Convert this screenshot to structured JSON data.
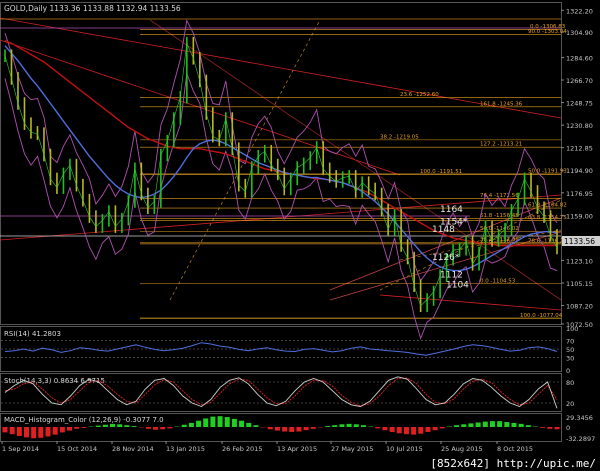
{
  "header": {
    "symbol": "GOLD",
    "timeframe": "Daily",
    "ohlc": "1133.36 1133.88 1132.94 1133.56"
  },
  "indicators": {
    "rsi": "RSI(14) 41.2803",
    "stoch": "Stoch(14,3,3) 0.8634 6.9715",
    "macd": "MACD_Histogram_Color (12,26,9) -0.3077 7.0"
  },
  "watermark": "[852x642] http://upic.me/",
  "chart_data": [
    {
      "type": "line",
      "panel": "price",
      "ylim": [
        1072.5,
        1328
      ],
      "x": [
        "1 Sep 2014",
        "15 Oct 2014",
        "28 Nov 2014",
        "13 Jan 2015",
        "26 Feb 2015",
        "13 Apr 2015",
        "27 May 2015",
        "10 Jul 2015",
        "25 Aug 2015",
        "8 Oct 2015"
      ],
      "y_ticks": [
        "1322.20",
        "1304.90",
        "1284.60",
        "1266.70",
        "1248.75",
        "1230.80",
        "1212.85",
        "1194.90",
        "1176.95",
        "1159.00",
        "1141.05",
        "1123.10",
        "1105.15",
        "1087.20",
        "1072.50"
      ],
      "current_price": "1133.56",
      "series": [
        {
          "name": "",
          "values": [
            1286,
            1268,
            1248,
            1232,
            1225,
            1224,
            1207,
            1188,
            1181,
            1192,
            1199,
            1183,
            1171,
            1158,
            1150,
            1155,
            1162,
            1150,
            1156,
            1170,
            1196,
            1176,
            1165,
            1170,
            1207,
            1218,
            1236,
            1253,
            1296,
            1284,
            1266,
            1240,
            1222,
            1219,
            1236,
            1212,
            1183,
            1178,
            1197,
            1206,
            1210,
            1199,
            1192,
            1180,
            1188,
            1197,
            1200,
            1205,
            1213,
            1196,
            1190,
            1186,
            1189,
            1190,
            1178,
            1185,
            1180,
            1176,
            1163,
            1148,
            1159,
            1135,
            1125,
            1103,
            1087,
            1092,
            1098,
            1111,
            1124,
            1131,
            1132,
            1138,
            1120,
            1129,
            1150,
            1139,
            1143,
            1148,
            1163,
            1172,
            1188,
            1178,
            1165,
            1158,
            1143,
            1133
          ]
        },
        {
          "name": "",
          "values": [
            1294,
            1288,
            1282,
            1275,
            1268,
            1262,
            1255,
            1248,
            1241,
            1234,
            1227,
            1220,
            1213,
            1206,
            1200,
            1194,
            1188,
            1183,
            1179,
            1176,
            1174,
            1173,
            1174,
            1176,
            1179,
            1184,
            1190,
            1197,
            1205,
            1212,
            1216,
            1218,
            1219,
            1218,
            1216,
            1213,
            1210,
            1207,
            1204,
            1201,
            1199,
            1197,
            1195,
            1193,
            1192,
            1191,
            1190,
            1189,
            1189,
            1188,
            1187,
            1186,
            1185,
            1183,
            1181,
            1178,
            1174,
            1170,
            1165,
            1160,
            1154,
            1148,
            1142,
            1136,
            1130,
            1125,
            1121,
            1118,
            1116,
            1115,
            1115,
            1116,
            1118,
            1121,
            1124,
            1127,
            1130,
            1133,
            1136,
            1139,
            1142,
            1144,
            1145,
            1146,
            1146,
            1145
          ]
        },
        {
          "name": "",
          "values": [
            1298,
            1296,
            1293,
            1290,
            1287,
            1284,
            1281,
            1277,
            1273,
            1269,
            1265,
            1261,
            1257,
            1253,
            1249,
            1245,
            1241,
            1237,
            1233,
            1229,
            1226,
            1223,
            1220,
            1218,
            1216,
            1214,
            1213,
            1212,
            1212,
            1212,
            1212,
            1211,
            1210,
            1209,
            1208,
            1206,
            1204,
            1202,
            1200,
            1198,
            1196,
            1195,
            1194,
            1193,
            1192,
            1191,
            1190,
            1189,
            1188,
            1188,
            1187,
            1186,
            1185,
            1183,
            1181,
            1179,
            1177,
            1174,
            1171,
            1168,
            1165,
            1162,
            1159,
            1156,
            1153,
            1150,
            1147,
            1145,
            1143,
            1141,
            1140,
            1139,
            1138,
            1137,
            1136,
            1136,
            1135,
            1135,
            1135,
            1135,
            1135,
            1135,
            1135,
            1135,
            1135,
            1135
          ]
        }
      ],
      "fib_labels": [
        "0.0 -1306.83",
        "90.0 -1303.04",
        "23.6 -1252.60",
        "161.8 -1245.36",
        "38.2 -1219.05",
        "127.2 -1213.21",
        "100.0 -1191.51",
        "50.0 -1191.93",
        "76.4 -1172.56",
        "61.8 -1164.82",
        "61.8 -1156.45",
        "50.0 -1146.02",
        "38.2 -1137.36",
        "23.6 -1136.27",
        "78.6 -1136.27",
        "0.0 -1104.53",
        "100.0 -1077.04",
        "63.8 -1154.75"
      ],
      "level_labels": [
        "1164",
        "1154*",
        "1148",
        "1126*",
        "1112",
        "1104"
      ]
    },
    {
      "type": "line",
      "panel": "rsi",
      "ylim": [
        0,
        100
      ],
      "y_ticks": [
        "100",
        "70",
        "50",
        "30",
        "0"
      ],
      "values": [
        44,
        46,
        50,
        45,
        52,
        48,
        42,
        46,
        53,
        51,
        47,
        45,
        50,
        55,
        60,
        54,
        49,
        46,
        48,
        52,
        58,
        65,
        62,
        57,
        54,
        49,
        46,
        50,
        53,
        48,
        45,
        44,
        49,
        51,
        47,
        43,
        46,
        52,
        55,
        50,
        48,
        46,
        44,
        42,
        38,
        35,
        40,
        45,
        50,
        56,
        60,
        58,
        54,
        49,
        45,
        47,
        53,
        55,
        51,
        44
      ]
    },
    {
      "type": "line",
      "panel": "stoch",
      "ylim": [
        0,
        100
      ],
      "y_ticks": [
        "80",
        "20"
      ],
      "series": [
        {
          "name": "",
          "values": [
            50,
            70,
            85,
            75,
            45,
            20,
            15,
            40,
            70,
            88,
            80,
            55,
            30,
            15,
            25,
            60,
            85,
            90,
            70,
            40,
            20,
            10,
            30,
            65,
            85,
            92,
            75,
            45,
            20,
            12,
            25,
            55,
            80,
            90,
            80,
            55,
            30,
            15,
            10,
            25,
            55,
            85,
            95,
            88,
            60,
            30,
            15,
            20,
            45,
            75,
            90,
            85,
            65,
            40,
            20,
            10,
            30,
            60,
            80,
            5
          ]
        },
        {
          "name": "",
          "values": [
            55,
            60,
            75,
            80,
            60,
            35,
            20,
            30,
            55,
            80,
            85,
            68,
            45,
            25,
            20,
            45,
            72,
            87,
            80,
            55,
            30,
            15,
            22,
            48,
            75,
            88,
            85,
            60,
            35,
            18,
            18,
            40,
            68,
            85,
            85,
            68,
            42,
            22,
            12,
            18,
            40,
            70,
            90,
            91,
            75,
            45,
            22,
            18,
            32,
            60,
            82,
            88,
            78,
            52,
            30,
            15,
            20,
            45,
            70,
            30
          ]
        }
      ]
    },
    {
      "type": "bar",
      "panel": "macd",
      "y_ticks": [
        "29.3456",
        "0",
        "-32.2897"
      ],
      "values": [
        -12,
        -16,
        -20,
        -23,
        -25,
        -24,
        -21,
        -17,
        -12,
        -8,
        -4,
        -2,
        1,
        3,
        5,
        7,
        6,
        4,
        2,
        -1,
        -4,
        -6,
        -5,
        -3,
        1,
        5,
        9,
        14,
        19,
        23,
        24,
        22,
        18,
        14,
        9,
        4,
        -1,
        -5,
        -8,
        -10,
        -11,
        -10,
        -7,
        -4,
        -1,
        2,
        4,
        6,
        7,
        6,
        4,
        1,
        -3,
        -7,
        -11,
        -14,
        -16,
        -17,
        -15,
        -11,
        -7,
        -3,
        1,
        4,
        6,
        8,
        10,
        12,
        13,
        13,
        11,
        9,
        7,
        4,
        1,
        -2,
        -4,
        -5
      ]
    }
  ],
  "colors": {
    "background": "#000000",
    "ma_fast": "#4f6fe0",
    "ma_mid": "#e02020",
    "ma_slow": "#c01010",
    "bollinger": "#b050b0",
    "fib": "#e8a020",
    "trendline": "#d02020",
    "macd_pos": "#20d020",
    "macd_neg": "#e02020"
  }
}
